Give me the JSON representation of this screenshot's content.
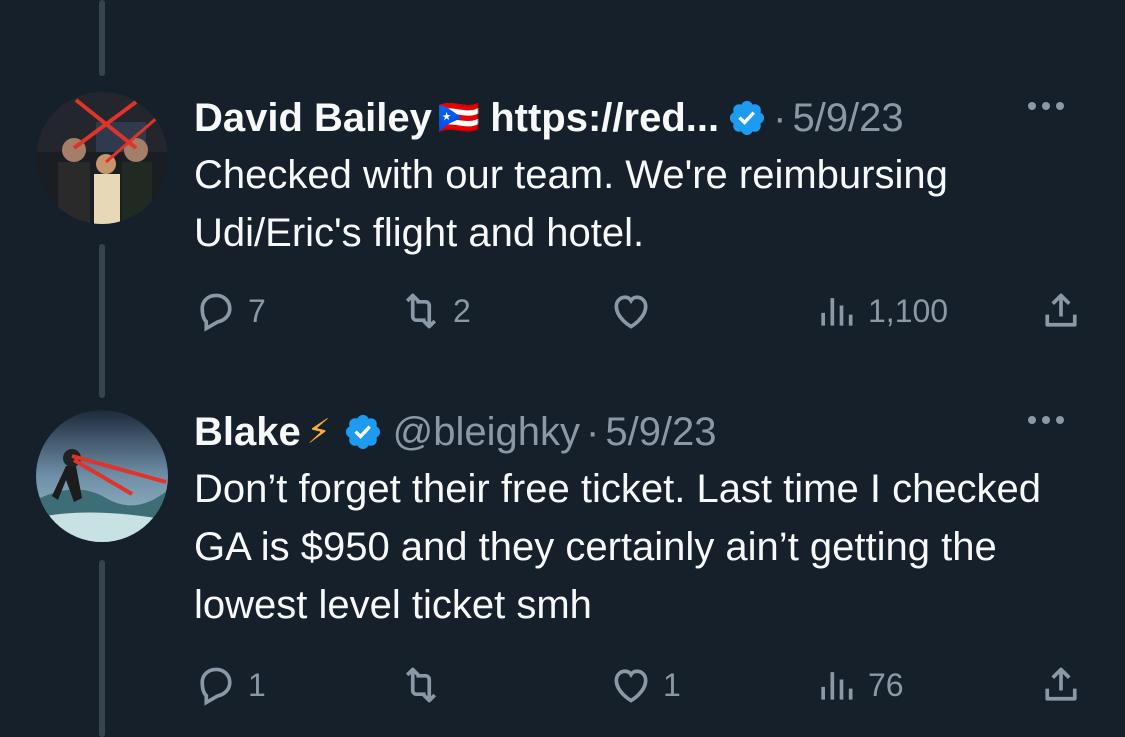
{
  "tweets": [
    {
      "name": "David Bailey",
      "emoji": "🇵🇷",
      "extra_label": "https://red...",
      "date": "5/9/23",
      "text": "Checked with our team. We're reimbursing Udi/Eric's flight and hotel.",
      "replies": "7",
      "retweets": "2",
      "likes": "",
      "views": "1,100"
    },
    {
      "name": "Blake",
      "emoji": "⚡",
      "handle": "@bleighky",
      "date": "5/9/23",
      "text": "Don’t forget their free ticket. Last time I checked GA is $950 and they certainly ain’t getting the lowest level ticket smh",
      "replies": "1",
      "retweets": "",
      "likes": "1",
      "views": "76"
    }
  ],
  "colors": {
    "background": "#15202b",
    "text": "#f7f9f9",
    "muted": "#8b98a5",
    "verified": "#1d9bf0",
    "thread_line": "#38444d"
  },
  "icons": [
    "reply-icon",
    "retweet-icon",
    "like-icon",
    "views-icon",
    "share-icon",
    "verified-badge-icon",
    "more-icon"
  ]
}
